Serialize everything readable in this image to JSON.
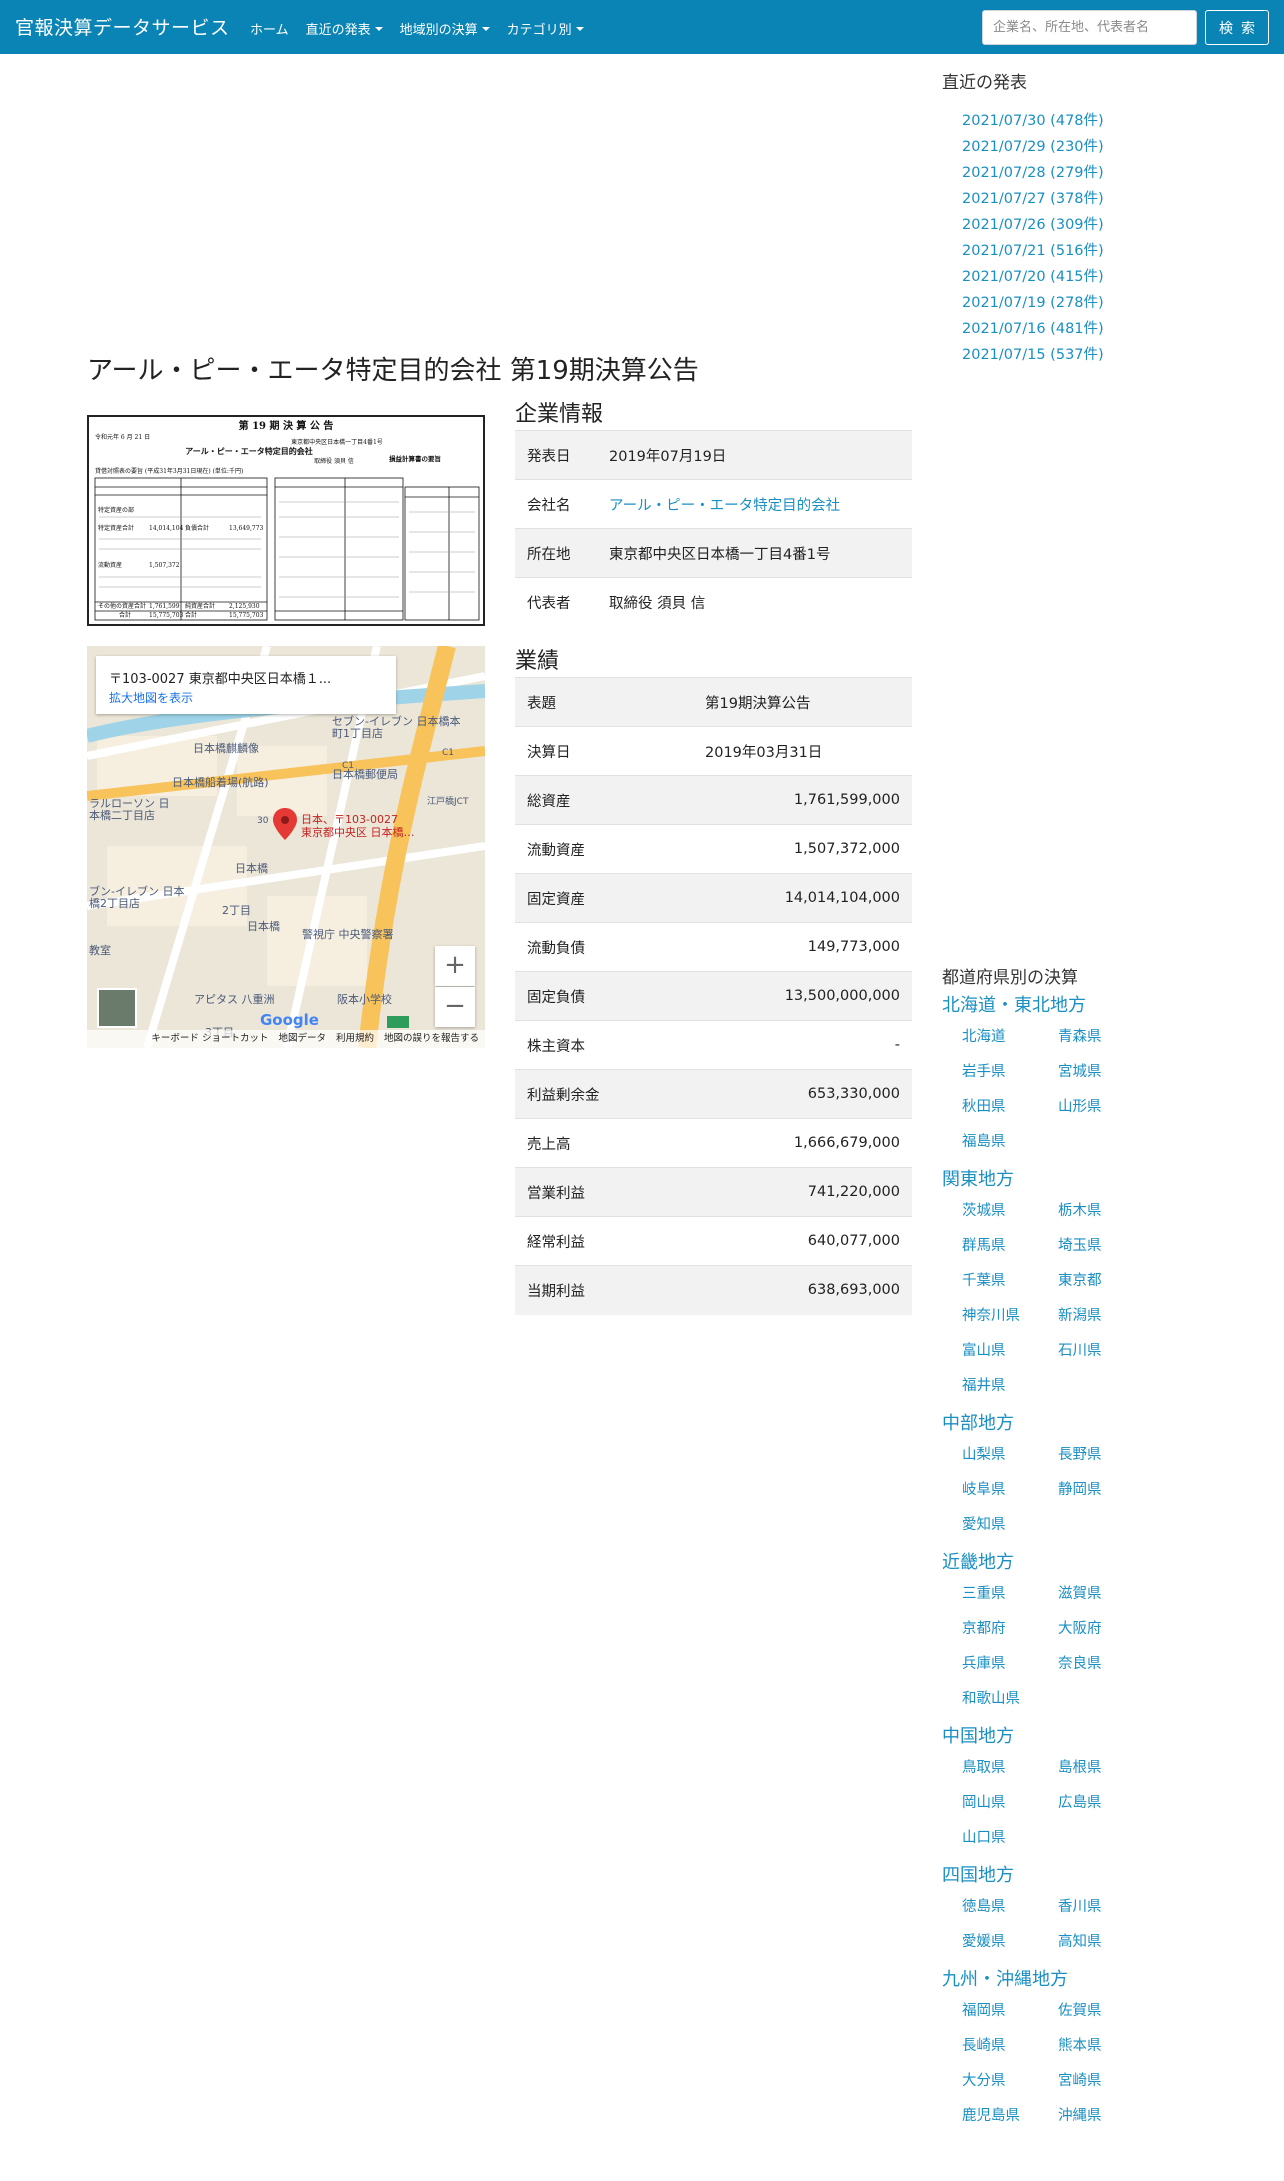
{
  "header": {
    "brand": "官報決算データサービス",
    "nav": [
      {
        "label": "ホーム",
        "dropdown": false
      },
      {
        "label": "直近の発表",
        "dropdown": true
      },
      {
        "label": "地域別の決算",
        "dropdown": true
      },
      {
        "label": "カテゴリ別",
        "dropdown": true
      }
    ],
    "search_placeholder": "企業名、所在地、代表者名",
    "search_button": "検索"
  },
  "sidebar": {
    "recent_title": "直近の発表",
    "recent": [
      "2021/07/30 (478件)",
      "2021/07/29 (230件)",
      "2021/07/28 (279件)",
      "2021/07/27 (378件)",
      "2021/07/26 (309件)",
      "2021/07/21 (516件)",
      "2021/07/20 (415件)",
      "2021/07/19 (278件)",
      "2021/07/16 (481件)",
      "2021/07/15 (537件)"
    ],
    "prefs_title": "都道府県別の決算",
    "regions": [
      {
        "name": "北海道・東北地方",
        "prefs": [
          "北海道",
          "青森県",
          "岩手県",
          "宮城県",
          "秋田県",
          "山形県",
          "福島県"
        ]
      },
      {
        "name": "関東地方",
        "prefs": [
          "茨城県",
          "栃木県",
          "群馬県",
          "埼玉県",
          "千葉県",
          "東京都",
          "神奈川県",
          "新潟県",
          "富山県",
          "石川県",
          "福井県"
        ]
      },
      {
        "name": "中部地方",
        "prefs": [
          "山梨県",
          "長野県",
          "岐阜県",
          "静岡県",
          "愛知県"
        ]
      },
      {
        "name": "近畿地方",
        "prefs": [
          "三重県",
          "滋賀県",
          "京都府",
          "大阪府",
          "兵庫県",
          "奈良県",
          "和歌山県"
        ]
      },
      {
        "name": "中国地方",
        "prefs": [
          "鳥取県",
          "島根県",
          "岡山県",
          "広島県",
          "山口県"
        ]
      },
      {
        "name": "四国地方",
        "prefs": [
          "徳島県",
          "香川県",
          "愛媛県",
          "高知県"
        ]
      },
      {
        "name": "九州・沖縄地方",
        "prefs": [
          "福岡県",
          "佐賀県",
          "長崎県",
          "熊本県",
          "大分県",
          "宮崎県",
          "鹿児島県",
          "沖縄県"
        ]
      }
    ]
  },
  "main": {
    "title": "アール・ピー・エータ特定目的会社 第19期決算公告",
    "notice_image": {
      "heading": "第 19 期 決 算 公 告",
      "date": "令和元年 6 月 21 日",
      "address": "東京都中央区日本橋一丁目4番1号",
      "company": "アール・ピー・エータ特定目的会社",
      "rep": "取締役 須貝 信",
      "bs_title": "貸借対照表の要旨 (平成31年3月31日現在) (単位:千円)",
      "pl_title": "損益計算書の要旨",
      "left_rows": [
        [
          "特定資産の部",
          "—"
        ],
        [
          "特定資産合計",
          "14,014,104"
        ],
        [
          "流動資産",
          "1,507,372"
        ],
        [
          "その他の資産合計",
          "1,761,599"
        ],
        [
          "合計",
          "15,775,703"
        ]
      ],
      "right_rows": [
        [
          "負債合計",
          "13,649,773"
        ],
        [
          "純資産合計",
          "2,125,930"
        ],
        [
          "合計",
          "15,775,703"
        ]
      ]
    },
    "map": {
      "card_title": "〒103-0027 東京都中央区日本橋１...",
      "card_link": "拡大地図を表示",
      "pin_label_1": "日本、〒103-0027",
      "pin_label_2": "東京都中央区 日本橋…",
      "zoom_in": "+",
      "zoom_out": "−",
      "logo": "Google",
      "footer": [
        "キーボード ショートカット",
        "地図データ",
        "利用規約",
        "地図の誤りを報告する"
      ],
      "places": [
        "日本橋麒麟像",
        "日本橋船着場(航路)",
        "日本橋郵便局",
        "セブン-イレブン 日本橋本町1丁目店",
        "ラルローソン 日本橋二丁目店",
        "ブン-イレブン 日本橋2丁目店",
        "日本橋",
        "2丁目",
        "日本橋",
        "警視庁 中央警察署",
        "アピタス 八重洲",
        "阪本小学校",
        "江戸橋JCT",
        "3丁目",
        "C1",
        "C1",
        "30",
        "教室"
      ]
    },
    "company_title": "企業情報",
    "company_info": [
      {
        "label": "発表日",
        "value": "2019年07月19日",
        "link": false
      },
      {
        "label": "会社名",
        "value": "アール・ピー・エータ特定目的会社",
        "link": true
      },
      {
        "label": "所在地",
        "value": "東京都中央区日本橋一丁目4番1号",
        "link": false
      },
      {
        "label": "代表者",
        "value": "取締役 須貝 信",
        "link": false
      }
    ],
    "performance_title": "業績",
    "performance": [
      {
        "label": "表題",
        "value": "第19期決算公告",
        "num": false
      },
      {
        "label": "決算日",
        "value": "2019年03月31日",
        "num": false
      },
      {
        "label": "総資産",
        "value": "1,761,599,000",
        "num": true
      },
      {
        "label": "流動資産",
        "value": "1,507,372,000",
        "num": true
      },
      {
        "label": "固定資産",
        "value": "14,014,104,000",
        "num": true
      },
      {
        "label": "流動負債",
        "value": "149,773,000",
        "num": true
      },
      {
        "label": "固定負債",
        "value": "13,500,000,000",
        "num": true
      },
      {
        "label": "株主資本",
        "value": "-",
        "num": true
      },
      {
        "label": "利益剰余金",
        "value": "653,330,000",
        "num": true
      },
      {
        "label": "売上高",
        "value": "1,666,679,000",
        "num": true
      },
      {
        "label": "営業利益",
        "value": "741,220,000",
        "num": true
      },
      {
        "label": "経常利益",
        "value": "640,077,000",
        "num": true
      },
      {
        "label": "当期利益",
        "value": "638,693,000",
        "num": true
      }
    ]
  }
}
